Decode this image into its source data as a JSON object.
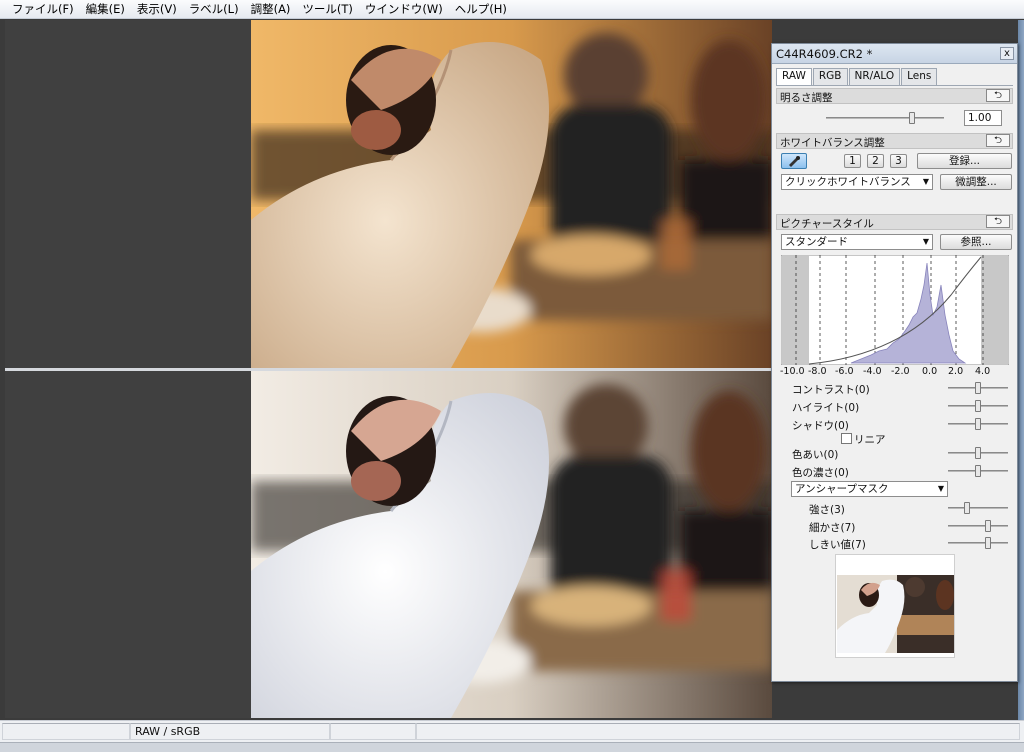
{
  "menu": [
    "ファイル(F)",
    "編集(E)",
    "表示(V)",
    "ラベル(L)",
    "調整(A)",
    "ツール(T)",
    "ウインドウ(W)",
    "ヘルプ(H)"
  ],
  "palette": {
    "title": "C44R4609.CR2 *",
    "close": "x",
    "tabs": [
      "RAW",
      "RGB",
      "NR/ALO",
      "Lens"
    ],
    "active_tab": "RAW",
    "brightness": {
      "header": "明るさ調整",
      "value": "1.00",
      "level": 0.73
    },
    "white_balance": {
      "header": "ホワイトバランス調整",
      "buttons": [
        "1",
        "2",
        "3"
      ],
      "register": "登録...",
      "mode": "クリックホワイトバランス",
      "fine_adjust": "微調整..."
    },
    "picture_style": {
      "header": "ピクチャースタイル",
      "style": "スタンダード",
      "browse": "参照..."
    },
    "histogram_axis": [
      "-10.0",
      "-8.0",
      "-6.0",
      "-4.0",
      "-2.0",
      "0.0",
      "2.0",
      "4.0"
    ],
    "adjustments": [
      {
        "label": "コントラスト(0)",
        "level": 0.5
      },
      {
        "label": "ハイライト(0)",
        "level": 0.5
      },
      {
        "label": "シャドウ(0)",
        "level": 0.5
      }
    ],
    "linear_label": "リニア",
    "color_adjustments": [
      {
        "label": "色あい(0)",
        "level": 0.5
      },
      {
        "label": "色の濃さ(0)",
        "level": 0.5
      }
    ],
    "sharpness_mode": "アンシャープマスク",
    "sharpness": [
      {
        "label": "強さ(3)",
        "level": 0.3
      },
      {
        "label": "細かさ(7)",
        "level": 0.7
      },
      {
        "label": "しきい値(7)",
        "level": 0.7
      }
    ]
  },
  "status": {
    "color": "RAW / sRGB"
  },
  "icons": {
    "undo": "undo-arrow-icon",
    "eyedropper": "eyedropper-icon"
  }
}
